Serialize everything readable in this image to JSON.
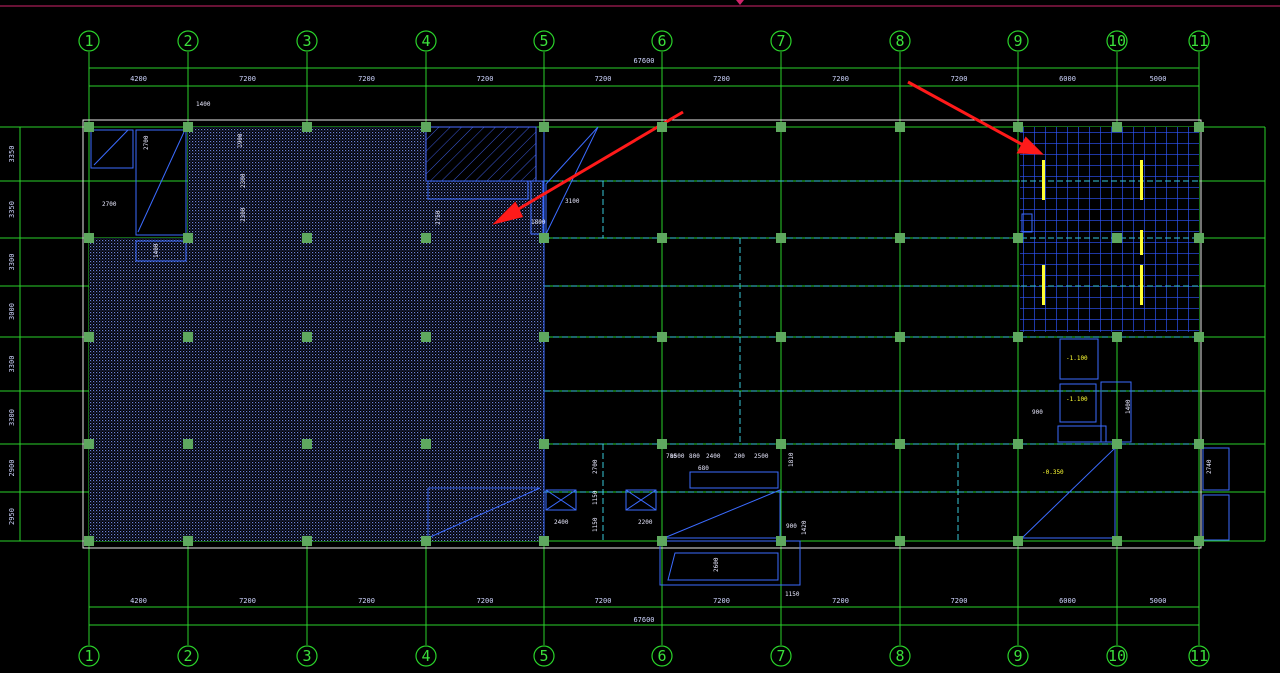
{
  "drawing": {
    "axis_labels": [
      "1",
      "2",
      "3",
      "4",
      "5",
      "6",
      "7",
      "8",
      "9",
      "10",
      "11"
    ],
    "span_dims": [
      "4200",
      "7200",
      "7200",
      "7200",
      "7200",
      "7200",
      "7200",
      "7200",
      "6000",
      "5000"
    ],
    "total_dim": "67600",
    "row_dims_left": [
      "3350",
      "3350",
      "3300",
      "3000",
      "3300",
      "3300",
      "2900",
      "2950"
    ],
    "labels": {
      "l_1400": "1400",
      "l_2700a": "2700",
      "l_2700b": "2700",
      "l_1400v": "1400",
      "l_1900": "1900",
      "l_2300": "2300",
      "l_2300b": "2300",
      "l_2750": "2750",
      "l_1800": "1800",
      "l_3100": "3100",
      "l_700": "700",
      "l_1500": "1500",
      "l_800": "800",
      "l_2400": "2400",
      "l_200": "200",
      "l_2500": "2500",
      "l_680": "680",
      "l_2700v": "2700",
      "l_1150": "1150",
      "l_2400b": "2400",
      "l_1150b": "1150",
      "l_2200": "2200",
      "l_1810": "1810",
      "l_900": "900",
      "l_1420": "1420",
      "l_2600": "2600",
      "l_1150c": "1150",
      "lvl_1": "-1.100",
      "lvl_2": "-1.100",
      "lvl_3": "-0.350",
      "l_2740": "2740",
      "l_900b": "900",
      "l_1400c": "1400"
    }
  }
}
